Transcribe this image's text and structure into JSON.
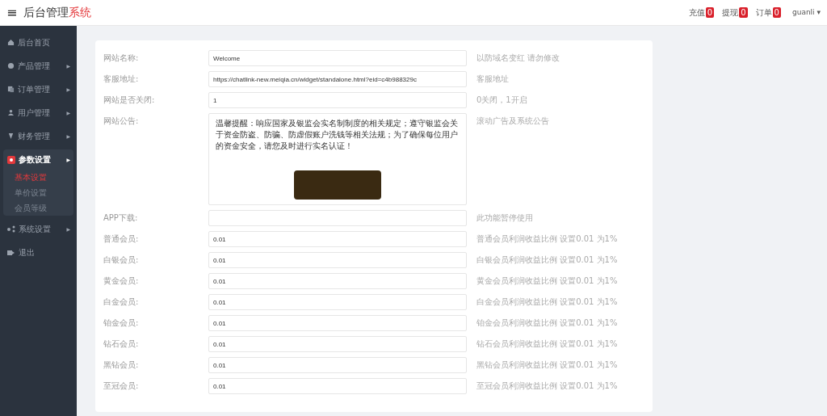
{
  "header": {
    "menu_icon": "≡",
    "title": "后台管理",
    "title_accent": "系统",
    "badges": [
      {
        "label": "充值",
        "count": "0"
      },
      {
        "label": "提现",
        "count": "0"
      },
      {
        "label": "订单",
        "count": "0"
      }
    ],
    "user": "guanli",
    "user_caret": "▾"
  },
  "sidebar": {
    "items": [
      {
        "label": "后台首页",
        "expanded": false,
        "selected": false
      },
      {
        "label": "产品管理",
        "arrow": "▶",
        "expanded": false,
        "selected": false
      },
      {
        "label": "订单管理",
        "arrow": "▶",
        "expanded": false,
        "selected": false
      },
      {
        "label": "用户管理",
        "arrow": "▶",
        "expanded": false,
        "selected": false
      },
      {
        "label": "财务管理",
        "arrow": "▶",
        "expanded": false,
        "selected": false
      },
      {
        "label": "参数设置",
        "arrow": "▶",
        "expanded": true,
        "selected": true,
        "children": [
          {
            "label": "基本设置",
            "selected": true
          },
          {
            "label": "单价设置",
            "selected": false
          },
          {
            "label": "会员等级",
            "selected": false
          }
        ]
      },
      {
        "label": "系统设置",
        "arrow": "▶",
        "expanded": false,
        "selected": false
      },
      {
        "label": "退出",
        "expanded": false,
        "selected": false
      }
    ]
  },
  "form": {
    "rows": [
      {
        "kind": "input",
        "label": "网站名称:",
        "value": "Welcome",
        "hint": "以防域名变红 请勿修改"
      },
      {
        "kind": "input",
        "label": "客服地址:",
        "value": "https://chatlink-new.meiqia.cn/widget/standalone.html?eid=c4b988329c",
        "hint": "客服地址"
      },
      {
        "kind": "input",
        "label": "网站是否关闭:",
        "value": "1",
        "hint": "0关闭，1开启"
      },
      {
        "kind": "textarea",
        "label": "网站公告:",
        "value": "温馨提醒：响应国家及银监会实名制制度的相关规定；遵守银监会关于资金防盗、防骗、防虚假账户洗钱等相关法规；为了确保每位用户的资金安全，请您及时进行实名认证！",
        "hint": "滚动广告及系统公告"
      },
      {
        "kind": "input",
        "label": "APP下载:",
        "value": "",
        "hint": "此功能暂停使用"
      },
      {
        "kind": "input",
        "label": "普通会员:",
        "value": "0.01",
        "hint": "普通会员利润收益比例 设置0.01 为1%"
      },
      {
        "kind": "input",
        "label": "白银会员:",
        "value": "0.01",
        "hint": "白银会员利润收益比例 设置0.01 为1%"
      },
      {
        "kind": "input",
        "label": "黄金会员:",
        "value": "0.01",
        "hint": "黄金会员利润收益比例 设置0.01 为1%"
      },
      {
        "kind": "input",
        "label": "白金会员:",
        "value": "0.01",
        "hint": "白金会员利润收益比例 设置0.01 为1%"
      },
      {
        "kind": "input",
        "label": "铂金会员:",
        "value": "0.01",
        "hint": "铂金会员利润收益比例 设置0.01 为1%"
      },
      {
        "kind": "input",
        "label": "钻石会员:",
        "value": "0.01",
        "hint": "钻石会员利润收益比例 设置0.01 为1%"
      },
      {
        "kind": "input",
        "label": "黑钻会员:",
        "value": "0.01",
        "hint": "黑钻会员利润收益比例 设置0.01 为1%"
      },
      {
        "kind": "input",
        "label": "至冠会员:",
        "value": "0.01",
        "hint": "至冠会员利润收益比例 设置0.01 为1%"
      }
    ]
  }
}
